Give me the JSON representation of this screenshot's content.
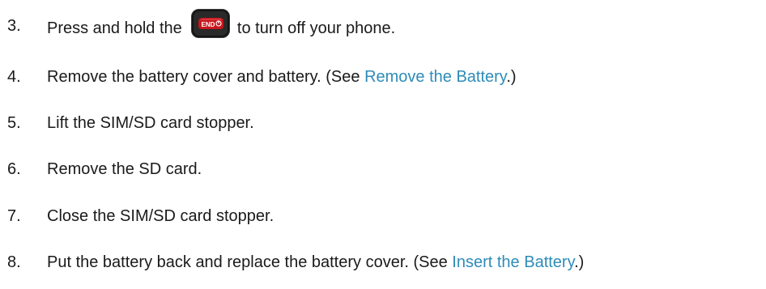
{
  "steps": [
    {
      "number": "3.",
      "before": "Press and hold the",
      "key_icon": "end-key-icon",
      "key_label": "END",
      "after": "to turn off your phone."
    },
    {
      "number": "4.",
      "before": "Remove the battery cover and battery. (See ",
      "link": "Remove the Battery",
      "after": ".)"
    },
    {
      "number": "5.",
      "text": "Lift the SIM/SD card stopper."
    },
    {
      "number": "6.",
      "text": "Remove the SD card."
    },
    {
      "number": "7.",
      "text": "Close the SIM/SD card stopper."
    },
    {
      "number": "8.",
      "before": "Put the battery back and replace the battery cover. (See ",
      "link": "Insert the Battery",
      "after": ".)"
    }
  ],
  "colors": {
    "text": "#1a1a1a",
    "link": "#2e8cb8",
    "end_key_body": "#1c1c1c",
    "end_key_face": "#c8161d",
    "end_key_label": "#ffffff"
  }
}
